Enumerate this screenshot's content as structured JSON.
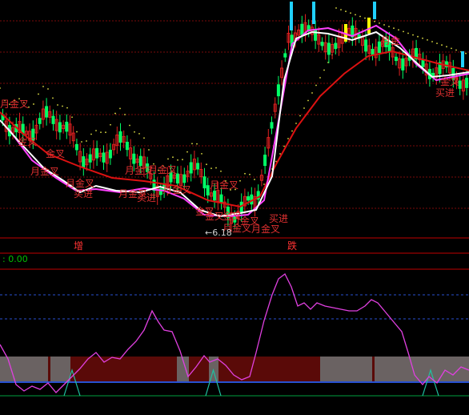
{
  "colors": {
    "background": "#000000",
    "grid_dashed": "#7a0a0a",
    "separator": "#c00000",
    "bull_candle": "#e02020",
    "bear_candle": "#00ff66",
    "ma_white": "#ffffff",
    "ma_magenta": "#ff40ff",
    "ma_red": "#dd1111",
    "dots": "#dddd44",
    "indicator_line": "#e040e0",
    "band_dark": "#5a0a08",
    "band_grey": "#6a6262",
    "blue_dashed": "#2850d0",
    "spike_green": "#20c0a0",
    "base_green": "#00a040"
  },
  "markers": {
    "zeng": "增",
    "die": "跌",
    "low_price": "←6.18"
  },
  "indicator": {
    "readout": ": 0.00"
  },
  "signals": [
    {
      "id": "s1",
      "text": "月金叉"
    },
    {
      "id": "s2",
      "text": "金叉"
    },
    {
      "id": "s3",
      "text": "金叉"
    },
    {
      "id": "s4",
      "text": "月金叉"
    },
    {
      "id": "s5",
      "text": "月金叉"
    },
    {
      "id": "s6",
      "text": "买进"
    },
    {
      "id": "s7",
      "text": "月金叉"
    },
    {
      "id": "s8",
      "text": "月金叉"
    },
    {
      "id": "s9",
      "text": "月金叉"
    },
    {
      "id": "s10",
      "text": "买进"
    },
    {
      "id": "s11",
      "text": "月金叉"
    },
    {
      "id": "s12",
      "text": "月金叉"
    },
    {
      "id": "s13",
      "text": "金叉"
    },
    {
      "id": "s14",
      "text": "金叉"
    },
    {
      "id": "s15",
      "text": "金叉"
    },
    {
      "id": "s16",
      "text": "金叉"
    },
    {
      "id": "s17",
      "text": "月金叉"
    },
    {
      "id": "s18",
      "text": "买进"
    },
    {
      "id": "s19",
      "text": "月金叉"
    },
    {
      "id": "s20",
      "text": "月金"
    },
    {
      "id": "s21",
      "text": "买进"
    },
    {
      "id": "s22",
      "text": "金叉"
    }
  ]
}
